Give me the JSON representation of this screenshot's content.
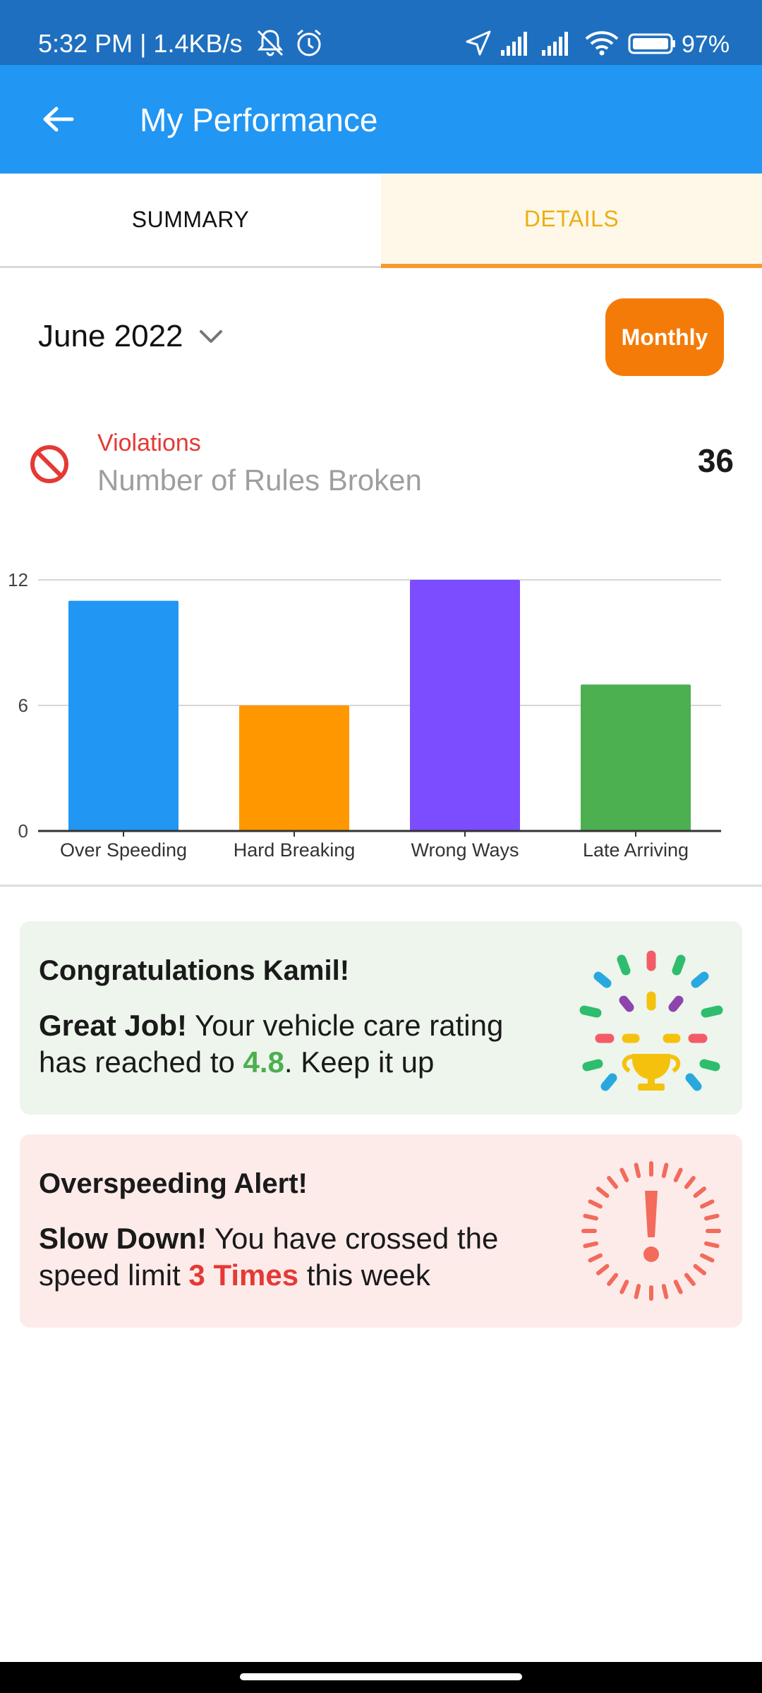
{
  "status": {
    "time": "5:32 PM | 1.4KB/s",
    "battery": "97%"
  },
  "app_bar": {
    "title": "My Performance",
    "back_icon": "arrow-left-icon"
  },
  "tabs": [
    {
      "label": "SUMMARY",
      "active": false
    },
    {
      "label": "DETAILS",
      "active": true
    }
  ],
  "filters": {
    "month": "June 2022",
    "period_button": "Monthly"
  },
  "violations": {
    "title": "Violations",
    "subtitle": "Number of Rules Broken",
    "count": "36",
    "icon": "no-entry-icon"
  },
  "chart_data": {
    "type": "bar",
    "categories": [
      "Over Speeding",
      "Hard Breaking",
      "Wrong Ways",
      "Late Arriving"
    ],
    "values": [
      11,
      6,
      12,
      7
    ],
    "colors": [
      "#2196F3",
      "#FF9800",
      "#7C4DFF",
      "#4CAF50"
    ],
    "ylim": [
      0,
      12
    ],
    "yticks": [
      0,
      6,
      12
    ],
    "grid": true
  },
  "congrats_card": {
    "title": "Congratulations Kamil!",
    "lead": "Great Job!",
    "text_1": " Your vehicle care rating has reached to ",
    "rating": "4.8",
    "text_2": ". Keep it up",
    "icon": "trophy-celebration-icon"
  },
  "alert_card": {
    "title": "Overspeeding Alert!",
    "lead": "Slow Down!",
    "text_1": " You have crossed the speed limit ",
    "times": "3 Times",
    "text_2": " this week",
    "icon": "alert-exclamation-icon"
  }
}
